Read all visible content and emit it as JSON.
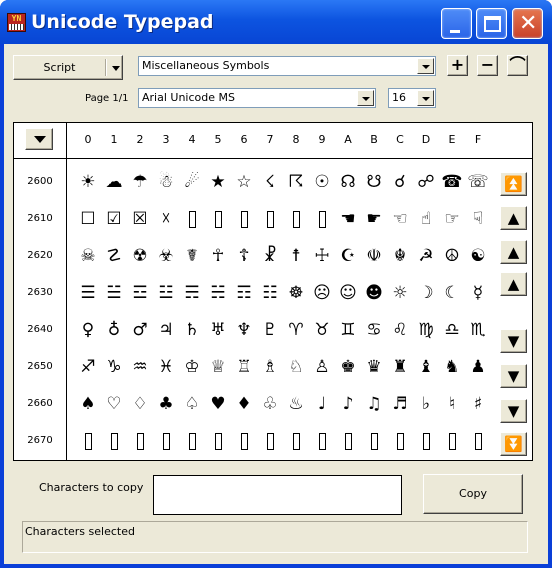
{
  "window": {
    "title": "Unicode Typepad",
    "icon_text": "YN"
  },
  "toolbar": {
    "script_label": "Script",
    "block_value": "Miscellaneous Symbols",
    "font_value": "Arial Unicode MS",
    "size_value": "16",
    "page_label": "Page 1/1",
    "plus_glyph": "+",
    "minus_glyph": "−",
    "curve_glyph": "⌒"
  },
  "grid": {
    "columns": [
      "0",
      "1",
      "2",
      "3",
      "4",
      "5",
      "6",
      "7",
      "8",
      "9",
      "A",
      "B",
      "C",
      "D",
      "E",
      "F"
    ],
    "rows": [
      {
        "label": "2600",
        "chars": [
          "☀",
          "☁",
          "☂",
          "☃",
          "☄",
          "★",
          "☆",
          "☇",
          "☈",
          "☉",
          "☊",
          "☋",
          "☌",
          "☍",
          "☎",
          "☏"
        ]
      },
      {
        "label": "2610",
        "chars": [
          "☐",
          "☑",
          "☒",
          "☓",
          "",
          "",
          "",
          "",
          "",
          "",
          "☚",
          "☛",
          "☜",
          "☝",
          "☞",
          "☟"
        ]
      },
      {
        "label": "2620",
        "chars": [
          "☠",
          "☡",
          "☢",
          "☣",
          "☤",
          "☥",
          "☦",
          "☧",
          "☨",
          "☩",
          "☪",
          "☫",
          "☬",
          "☭",
          "☮",
          "☯"
        ]
      },
      {
        "label": "2630",
        "chars": [
          "☰",
          "☱",
          "☲",
          "☳",
          "☴",
          "☵",
          "☶",
          "☷",
          "☸",
          "☹",
          "☺",
          "☻",
          "☼",
          "☽",
          "☾",
          "☿"
        ]
      },
      {
        "label": "2640",
        "chars": [
          "♀",
          "♁",
          "♂",
          "♃",
          "♄",
          "♅",
          "♆",
          "♇",
          "♈",
          "♉",
          "♊",
          "♋",
          "♌",
          "♍",
          "♎",
          "♏"
        ]
      },
      {
        "label": "2650",
        "chars": [
          "♐",
          "♑",
          "♒",
          "♓",
          "♔",
          "♕",
          "♖",
          "♗",
          "♘",
          "♙",
          "♚",
          "♛",
          "♜",
          "♝",
          "♞",
          "♟"
        ]
      },
      {
        "label": "2660",
        "chars": [
          "♠",
          "♡",
          "♢",
          "♣",
          "♤",
          "♥",
          "♦",
          "♧",
          "♨",
          "♩",
          "♪",
          "♫",
          "♬",
          "♭",
          "♮",
          "♯"
        ]
      },
      {
        "label": "2670",
        "chars": [
          "",
          "",
          "",
          "",
          "",
          "",
          "",
          "",
          "",
          "",
          "",
          "",
          "",
          "",
          "",
          ""
        ]
      }
    ]
  },
  "nav": [
    "⏫",
    "▲",
    "▲",
    "▲",
    "▼",
    "▼",
    "▼",
    "⏬"
  ],
  "copy": {
    "label": "Characters to copy",
    "value": "",
    "button": "Copy"
  },
  "status": {
    "text": "Characters selected"
  }
}
